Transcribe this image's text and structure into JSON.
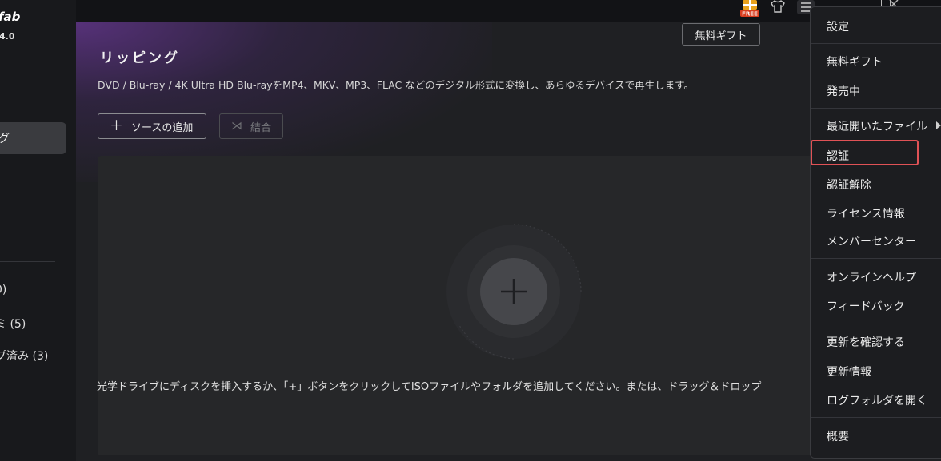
{
  "sidebar": {
    "brand": "fab",
    "version": "4.0",
    "active_item": "グ",
    "items": [
      {
        "label": "0)"
      },
      {
        "label": "ミ (5)"
      },
      {
        "label": "プ済み (3)"
      }
    ]
  },
  "topbar": {
    "free_badge": "FREE",
    "icons": [
      "gift-free-icon",
      "tshirt-icon",
      "menu-icon",
      "maximize-icon",
      "close-icon"
    ]
  },
  "tooltip": {
    "text": "無料ギフト"
  },
  "main": {
    "title": "リッピング",
    "description": "DVD / Blu-ray / 4K Ultra HD Blu-rayをMP4、MKV、MP3、FLAC などのデジタル形式に変換し、あらゆるデバイスで再生します。",
    "add_source_label": "ソースの追加",
    "merge_label": "結合",
    "drop_hint": "光学ドライブにディスクを挿入するか、「+」ボタンをクリックしてISOファイルやフォルダを追加してください。または、ドラッグ＆ドロップ"
  },
  "menu": {
    "items": [
      {
        "label": "設定"
      },
      {
        "label": "無料ギフト"
      },
      {
        "label": "発売中"
      },
      {
        "label": "最近開いたファイル"
      },
      {
        "label": "認証"
      },
      {
        "label": "認証解除"
      },
      {
        "label": "ライセンス情報"
      },
      {
        "label": "メンバーセンター"
      },
      {
        "label": "オンラインヘルプ"
      },
      {
        "label": "フィードバック"
      },
      {
        "label": "更新を確認する"
      },
      {
        "label": "更新情報"
      },
      {
        "label": "ログフォルダを開く"
      },
      {
        "label": "概要"
      }
    ],
    "highlighted_item": "認証"
  },
  "colors": {
    "accent_purple": "#6a3796",
    "highlight_red": "#e05256",
    "free_badge": "#e8a21c"
  }
}
